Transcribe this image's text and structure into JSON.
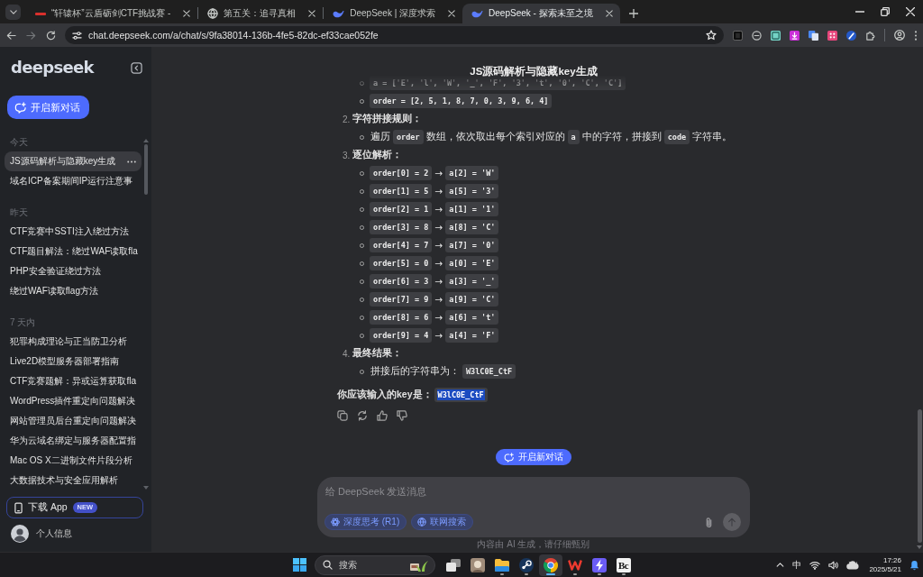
{
  "browser": {
    "tabs": [
      {
        "kind": "dash",
        "title": "“轩辕杯”云盾砺剑CTF挑战赛 -",
        "selected": false
      },
      {
        "kind": "globe",
        "title": "第五关：追寻真相",
        "selected": false
      },
      {
        "kind": "whale",
        "title": "DeepSeek | 深度求索",
        "selected": false
      },
      {
        "kind": "whale",
        "title": "DeepSeek - 探索未至之境",
        "selected": true
      }
    ],
    "address_bar": {
      "url": "chat.deepseek.com/a/chat/s/9fa38014-136b-4fe5-82dc-ef33cae052fe"
    }
  },
  "sidebar": {
    "logo": "deepseek",
    "new_chat_button": "开启新对话",
    "sections": [
      {
        "label": "今天",
        "items": [
          {
            "title": "JS源码解析与隐藏key生成",
            "selected": true
          },
          {
            "title": "域名ICP备案期间IP运行注意事",
            "selected": false
          }
        ]
      },
      {
        "label": "昨天",
        "items": [
          {
            "title": "CTF竞赛中SSTI注入绕过方法",
            "selected": false
          },
          {
            "title": "CTF题目解法：绕过WAF读取fla",
            "selected": false
          },
          {
            "title": "PHP安全验证绕过方法",
            "selected": false
          },
          {
            "title": "绕过WAF读取flag方法",
            "selected": false
          }
        ]
      },
      {
        "label": "7 天内",
        "items": [
          {
            "title": "犯罪构成理论与正当防卫分析",
            "selected": false
          },
          {
            "title": "Live2D模型服务器部署指南",
            "selected": false
          },
          {
            "title": "CTF竞赛题解：异或运算获取fla",
            "selected": false
          },
          {
            "title": "WordPress插件重定向问题解决",
            "selected": false
          },
          {
            "title": "网站管理员后台重定向问题解决",
            "selected": false
          },
          {
            "title": "华为云域名绑定与服务器配置指",
            "selected": false
          },
          {
            "title": "Mac OS X二进制文件片段分析",
            "selected": false
          },
          {
            "title": "大数据技术与安全应用解析",
            "selected": false
          }
        ]
      }
    ],
    "download_app": {
      "label": "下载 App",
      "badge": "NEW"
    },
    "profile": {
      "label": "个人信息"
    }
  },
  "chat": {
    "title": "JS源码解析与隐藏key生成",
    "answer": {
      "items": [
        {
          "bullets": [
            {
              "segments": [
                {
                  "kind": "code",
                  "text": "a = ['E', 'l', 'W', '_', 'F', '3', 't', '0', 'C', 'C']"
                }
              ]
            },
            {
              "segments": [
                {
                  "kind": "code",
                  "text": "order = [2, 5, 1, 8, 7, 0, 3, 9, 6, 4]"
                }
              ]
            }
          ]
        },
        {
          "number": "2.",
          "heading": "字符拼接规则：",
          "bullets": [
            {
              "segments": [
                {
                  "kind": "text",
                  "text": "遍历"
                },
                {
                  "kind": "code",
                  "text": "order"
                },
                {
                  "kind": "text",
                  "text": "数组，依次取出每个索引对应的"
                },
                {
                  "kind": "code",
                  "text": "a"
                },
                {
                  "kind": "text",
                  "text": "中的字符，拼接到"
                },
                {
                  "kind": "code",
                  "text": "code"
                },
                {
                  "kind": "text",
                  "text": "字符串。"
                }
              ]
            }
          ]
        },
        {
          "number": "3.",
          "heading": "逐位解析：",
          "bullets": [
            {
              "segments": [
                {
                  "kind": "code",
                  "text": "order[0] = 2"
                },
                {
                  "kind": "text",
                  "text": "→"
                },
                {
                  "kind": "code",
                  "text": "a[2] = 'W'"
                }
              ]
            },
            {
              "segments": [
                {
                  "kind": "code",
                  "text": "order[1] = 5"
                },
                {
                  "kind": "text",
                  "text": "→"
                },
                {
                  "kind": "code",
                  "text": "a[5] = '3'"
                }
              ]
            },
            {
              "segments": [
                {
                  "kind": "code",
                  "text": "order[2] = 1"
                },
                {
                  "kind": "text",
                  "text": "→"
                },
                {
                  "kind": "code",
                  "text": "a[1] = '1'"
                }
              ]
            },
            {
              "segments": [
                {
                  "kind": "code",
                  "text": "order[3] = 8"
                },
                {
                  "kind": "text",
                  "text": "→"
                },
                {
                  "kind": "code",
                  "text": "a[8] = 'C'"
                }
              ]
            },
            {
              "segments": [
                {
                  "kind": "code",
                  "text": "order[4] = 7"
                },
                {
                  "kind": "text",
                  "text": "→"
                },
                {
                  "kind": "code",
                  "text": "a[7] = '0'"
                }
              ]
            },
            {
              "segments": [
                {
                  "kind": "code",
                  "text": "order[5] = 0"
                },
                {
                  "kind": "text",
                  "text": "→"
                },
                {
                  "kind": "code",
                  "text": "a[0] = 'E'"
                }
              ]
            },
            {
              "segments": [
                {
                  "kind": "code",
                  "text": "order[6] = 3"
                },
                {
                  "kind": "text",
                  "text": "→"
                },
                {
                  "kind": "code",
                  "text": "a[3] = '_'"
                }
              ]
            },
            {
              "segments": [
                {
                  "kind": "code",
                  "text": "order[7] = 9"
                },
                {
                  "kind": "text",
                  "text": "→"
                },
                {
                  "kind": "code",
                  "text": "a[9] = 'C'"
                }
              ]
            },
            {
              "segments": [
                {
                  "kind": "code",
                  "text": "order[8] = 6"
                },
                {
                  "kind": "text",
                  "text": "→"
                },
                {
                  "kind": "code",
                  "text": "a[6] = 't'"
                }
              ]
            },
            {
              "segments": [
                {
                  "kind": "code",
                  "text": "order[9] = 4"
                },
                {
                  "kind": "text",
                  "text": "→"
                },
                {
                  "kind": "code",
                  "text": "a[4] = 'F'"
                }
              ]
            }
          ]
        },
        {
          "number": "4.",
          "heading": "最终结果：",
          "bullets": [
            {
              "segments": [
                {
                  "kind": "text",
                  "text": "拼接后的字符串为："
                },
                {
                  "kind": "code",
                  "text": "W3lC0E_CtF"
                }
              ]
            }
          ]
        }
      ],
      "conclusion": {
        "label": "你应该输入的key是：",
        "value": "W3lC0E_CtF",
        "value_selected": true
      }
    },
    "new_chat_button": "开启新对话",
    "composer": {
      "placeholder": "给 DeepSeek 发送消息",
      "toggles": [
        {
          "kind": "atom",
          "label": "深度思考 (R1)",
          "selected": true
        },
        {
          "kind": "globe",
          "label": "联网搜索",
          "selected": true
        }
      ]
    },
    "disclaimer": "内容由 AI 生成，请仔细甄别"
  },
  "taskbar": {
    "search": {
      "placeholder": "搜索"
    },
    "apps": [
      {
        "kind": "task_view",
        "selected": false,
        "running": false
      },
      {
        "kind": "picture",
        "selected": false,
        "running": false
      },
      {
        "kind": "folder",
        "selected": false,
        "running": true
      },
      {
        "kind": "linked_circles",
        "selected": false,
        "running": true
      },
      {
        "kind": "browser",
        "selected": true,
        "running": true
      },
      {
        "kind": "zigzag",
        "selected": false,
        "running": true
      },
      {
        "kind": "lightning",
        "selected": false,
        "running": true
      },
      {
        "kind": "letters",
        "label": "Bc",
        "selected": false,
        "running": true
      }
    ],
    "tray": {
      "ime": "中",
      "time": "17:26",
      "date": "2025/5/21"
    }
  }
}
